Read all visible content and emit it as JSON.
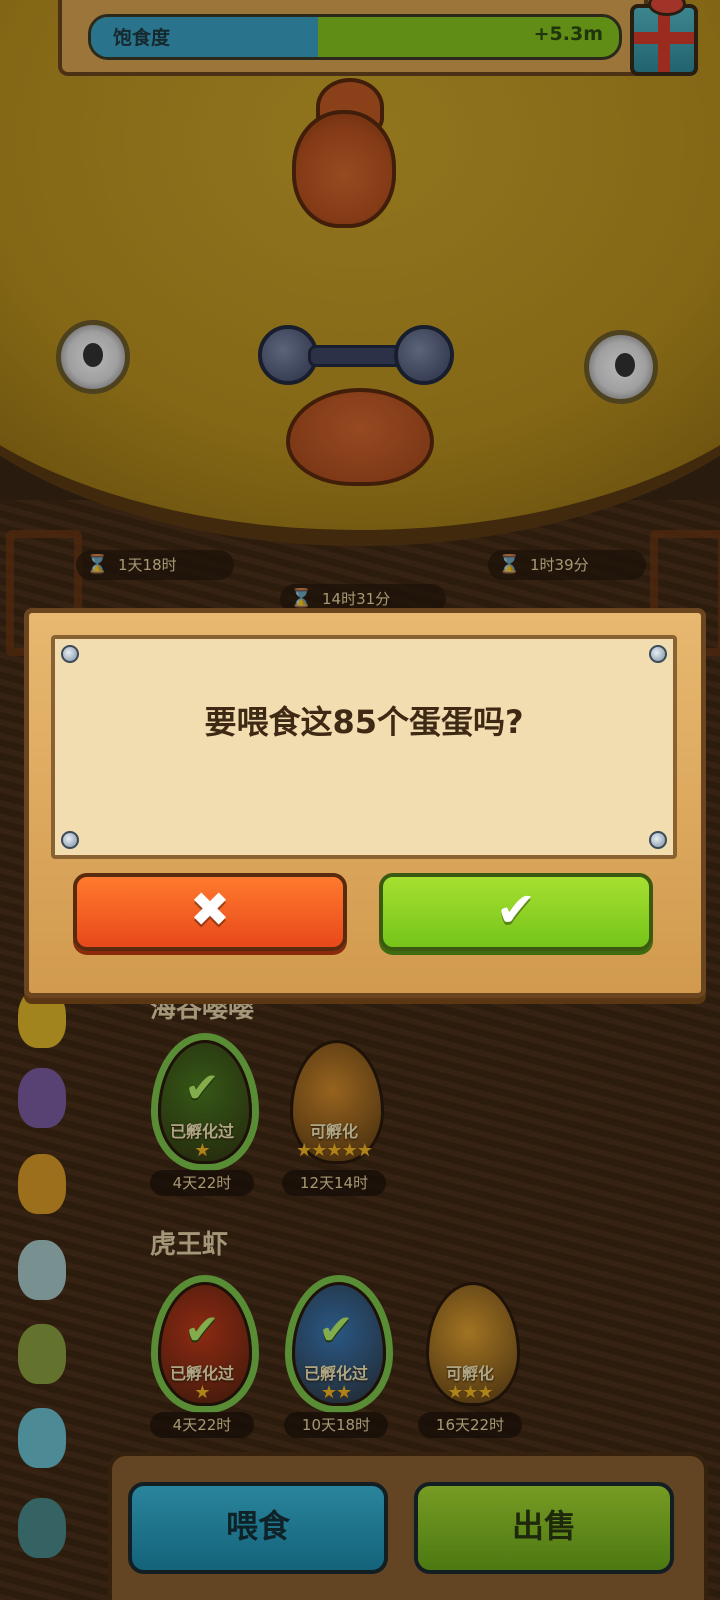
{
  "hud": {
    "hunger_label": "饱食度",
    "hunger_value": "+5.3m",
    "hunger_progress_percent": 43
  },
  "timers": [
    {
      "label": "1天18时"
    },
    {
      "label": "14时31分"
    },
    {
      "label": "1时39分"
    }
  ],
  "dialog": {
    "question": "要喂食这85个蛋蛋吗?",
    "cancel_icon": "close-x-icon",
    "confirm_icon": "check-icon",
    "cancel_color": "#f05a1e",
    "confirm_color": "#8ed424"
  },
  "groups": [
    {
      "title": "海谷嘤嘤",
      "eggs": [
        {
          "state": "已孵化过",
          "stars": 1,
          "time": "4天22时",
          "color": "#4a7a20",
          "hatched": true
        },
        {
          "state": "可孵化",
          "stars": 5,
          "time": "12天14时",
          "color": "#d18a2a",
          "hatched": false
        }
      ]
    },
    {
      "title": "虎王虾",
      "eggs": [
        {
          "state": "已孵化过",
          "stars": 1,
          "time": "4天22时",
          "color": "#c23a1a",
          "hatched": true
        },
        {
          "state": "已孵化过",
          "stars": 2,
          "time": "10天18时",
          "color": "#3a7ab8",
          "hatched": true
        },
        {
          "state": "可孵化",
          "stars": 3,
          "time": "16天22时",
          "color": "#e0a030",
          "hatched": false
        }
      ]
    }
  ],
  "bottom": {
    "feed_label": "喂食",
    "sell_label": "出售"
  }
}
